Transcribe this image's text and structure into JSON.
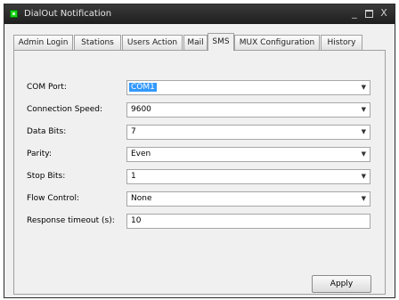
{
  "window": {
    "title": "DialOut Notification"
  },
  "titlebar": {
    "minimize": "_",
    "close": "X"
  },
  "tabs": [
    {
      "label": "Admin Login"
    },
    {
      "label": "Stations"
    },
    {
      "label": "Users Action"
    },
    {
      "label": "Mail"
    },
    {
      "label": "SMS",
      "active": true
    },
    {
      "label": "MUX Configuration"
    },
    {
      "label": "History"
    }
  ],
  "form": {
    "com_port": {
      "label": "COM Port:",
      "value": "COM1"
    },
    "connection_speed": {
      "label": "Connection Speed:",
      "value": "9600"
    },
    "data_bits": {
      "label": "Data Bits:",
      "value": "7"
    },
    "parity": {
      "label": "Parity:",
      "value": "Even"
    },
    "stop_bits": {
      "label": "Stop Bits:",
      "value": "1"
    },
    "flow_control": {
      "label": "Flow Control:",
      "value": "None"
    },
    "response_timeout": {
      "label": "Response timeout (s):",
      "value": "10"
    }
  },
  "actions": {
    "apply_label": "Apply"
  },
  "icons": {
    "dropdown": "chevron-down-icon",
    "app": "app-icon"
  }
}
